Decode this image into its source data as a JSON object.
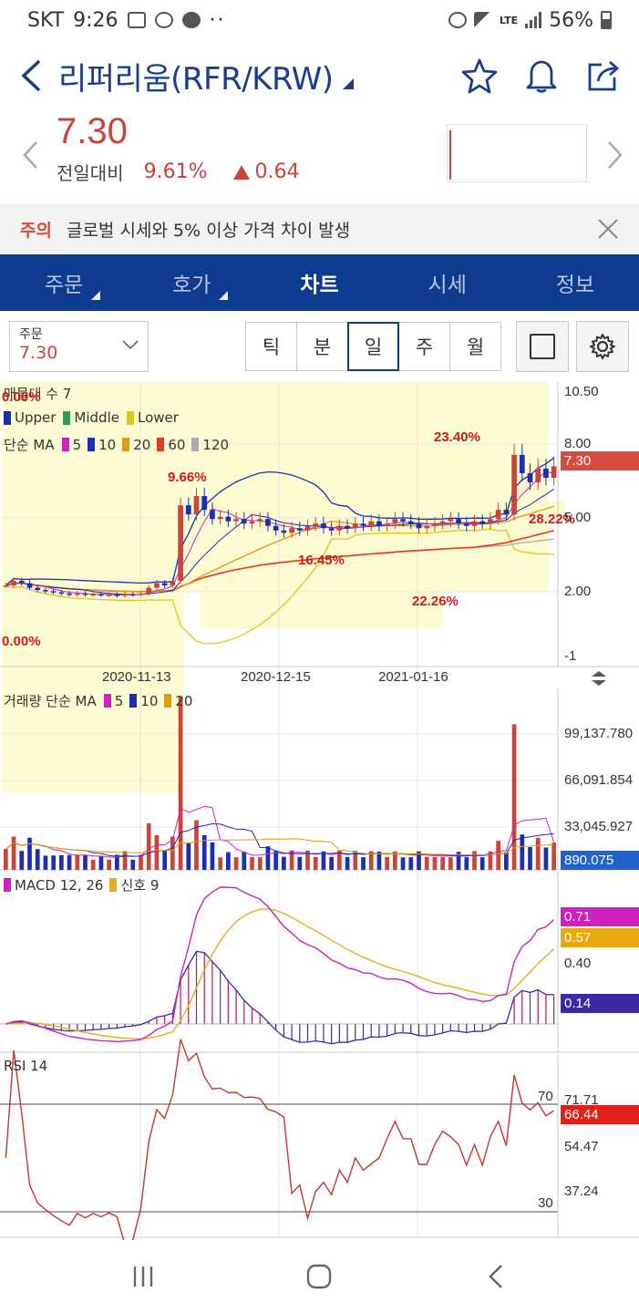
{
  "status": {
    "carrier": "SKT",
    "time": "9:26",
    "network": "LTE",
    "battery": "56%"
  },
  "header": {
    "title": "리퍼리움(RFR/KRW)"
  },
  "quote": {
    "price": "7.30",
    "change_label": "전일대비",
    "change_pct": "9.61%",
    "change_amount": "0.64"
  },
  "notice": {
    "tag": "주의",
    "text": "글로벌 시세와 5% 이상 가격 차이 발생"
  },
  "tabs": [
    {
      "label": "주문"
    },
    {
      "label": "호가"
    },
    {
      "label": "차트"
    },
    {
      "label": "시세"
    },
    {
      "label": "정보"
    }
  ],
  "order": {
    "label": "주문",
    "value": "7.30"
  },
  "periods": [
    "틱",
    "분",
    "일",
    "주",
    "월"
  ],
  "colors": {
    "accent": "#0d3b8e",
    "up": "#c8453b",
    "down": "#1c2fb0",
    "band_fill": "#fdfbd0"
  },
  "chart_data": [
    {
      "type": "line",
      "panel": "price",
      "legend_title": "매물대 수 7",
      "band_labels": [
        "Upper",
        "Middle",
        "Lower"
      ],
      "ma_label": "단순 MA",
      "ma_periods": [
        "5",
        "10",
        "20",
        "60",
        "120"
      ],
      "yticks": [
        "10.50",
        "8.00",
        "5.00",
        "2.00",
        "-1"
      ],
      "last_value": "7.30",
      "volume_profile_pcts": [
        "0.00%",
        "9.66%",
        "23.40%",
        "28.22%",
        "16.45%",
        "22.26%",
        "0.00%"
      ],
      "xticks": [
        "2020-11-13",
        "2020-12-15",
        "2021-01-16"
      ],
      "ylim": [
        -1,
        10.5
      ],
      "close_series": [
        2.1,
        2.3,
        2.2,
        2.0,
        1.9,
        1.85,
        1.8,
        1.75,
        1.7,
        1.75,
        1.7,
        1.72,
        1.68,
        1.7,
        1.65,
        1.72,
        1.7,
        1.75,
        2.0,
        2.2,
        2.1,
        2.3,
        5.6,
        5.2,
        6.0,
        5.4,
        5.0,
        5.1,
        4.9,
        5.0,
        4.8,
        4.9,
        5.0,
        4.7,
        4.5,
        4.4,
        4.6,
        4.5,
        4.7,
        4.8,
        4.6,
        4.5,
        4.7,
        4.6,
        4.8,
        4.7,
        4.9,
        4.7,
        4.8,
        5.0,
        4.9,
        4.8,
        4.6,
        4.7,
        4.8,
        4.9,
        5.0,
        4.8,
        4.7,
        4.9,
        4.8,
        5.0,
        5.4,
        5.2,
        7.8,
        7.0,
        6.6,
        7.2,
        6.8,
        7.3
      ]
    },
    {
      "type": "bar",
      "panel": "volume",
      "label": "거래량 단순 MA",
      "ma_periods": [
        "5",
        "10",
        "20"
      ],
      "yticks": [
        "99,137.780",
        "66,091.854",
        "33,045.927"
      ],
      "last_value": "890.075"
    },
    {
      "type": "line",
      "panel": "macd",
      "label": "MACD 12, 26",
      "signal_label": "신호 9",
      "yticks": [
        "0.40"
      ],
      "macd_last": "0.71",
      "signal_last": "0.57",
      "hist_last": "0.14"
    },
    {
      "type": "line",
      "panel": "rsi",
      "label": "RSI 14",
      "levels": [
        "70",
        "30"
      ],
      "yticks": [
        "71.71",
        "54.47",
        "37.24"
      ],
      "last_value": "66.44"
    }
  ]
}
